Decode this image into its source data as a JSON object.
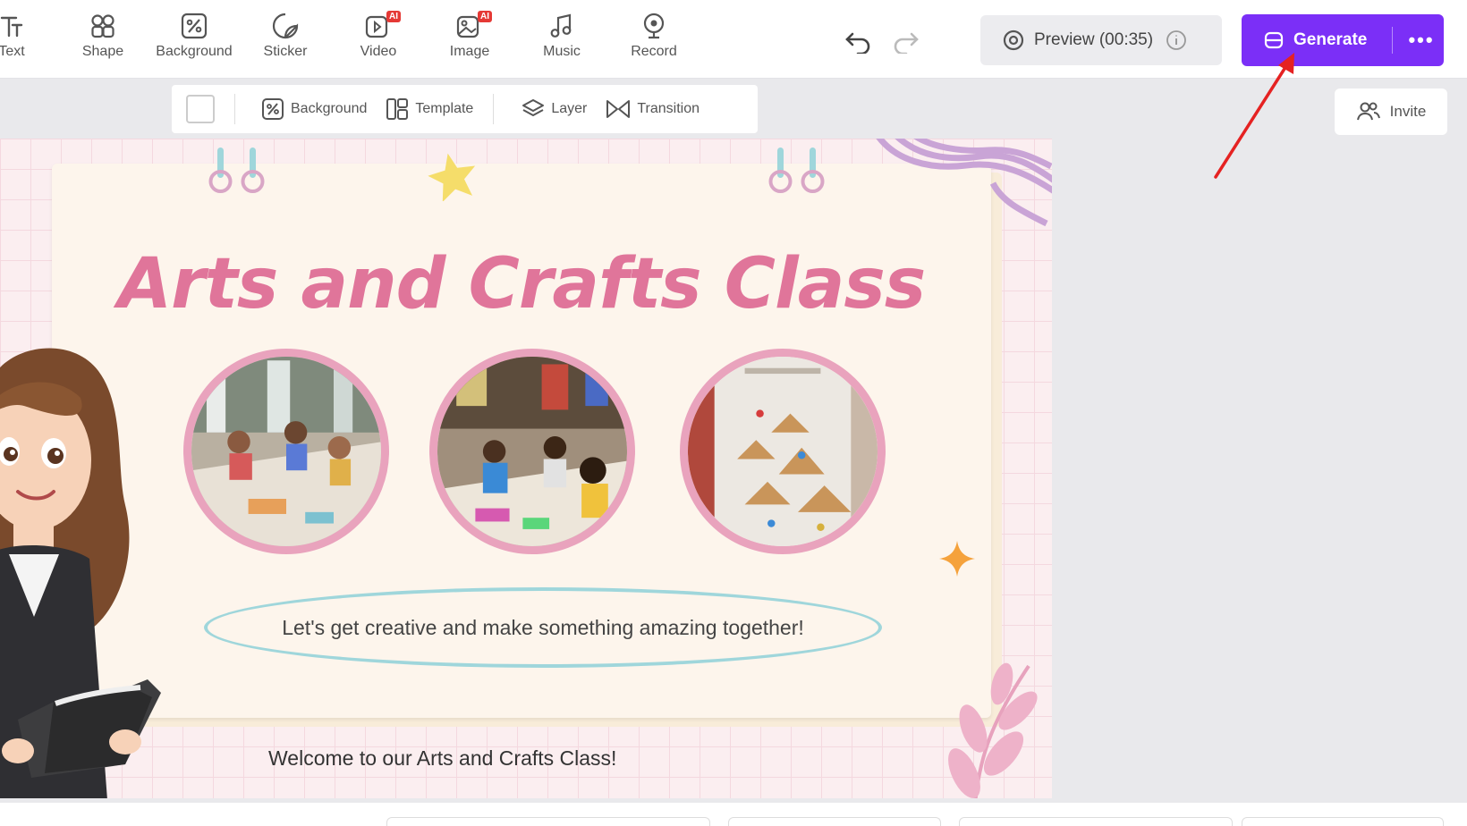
{
  "toolbar": {
    "tools": [
      {
        "label": "Text",
        "icon": "text-icon"
      },
      {
        "label": "Shape",
        "icon": "shape-icon"
      },
      {
        "label": "Background",
        "icon": "background-icon"
      },
      {
        "label": "Sticker",
        "icon": "sticker-icon"
      },
      {
        "label": "Video",
        "icon": "video-icon",
        "badge": "AI"
      },
      {
        "label": "Image",
        "icon": "image-icon",
        "badge": "AI"
      },
      {
        "label": "Music",
        "icon": "music-icon"
      },
      {
        "label": "Record",
        "icon": "record-icon"
      }
    ],
    "preview_label": "Preview (00:35)",
    "generate_label": "Generate",
    "more_label": "•••"
  },
  "subtoolbar": {
    "items": [
      {
        "label": "Background",
        "icon": "background-icon"
      },
      {
        "label": "Template",
        "icon": "template-icon"
      },
      {
        "label": "Layer",
        "icon": "layer-icon"
      },
      {
        "label": "Transition",
        "icon": "transition-icon"
      }
    ]
  },
  "invite_label": "Invite",
  "slide": {
    "title": "Arts and Crafts Class",
    "tagline": "Let's get creative and make something amazing together!",
    "caption": "Welcome to our Arts and Crafts Class!"
  },
  "colors": {
    "accent": "#7b2ff7",
    "title_pink": "#e0759a",
    "photo_border": "#e9a3bd",
    "tagline_border": "#9fd6db",
    "arrow": "#e52222"
  }
}
